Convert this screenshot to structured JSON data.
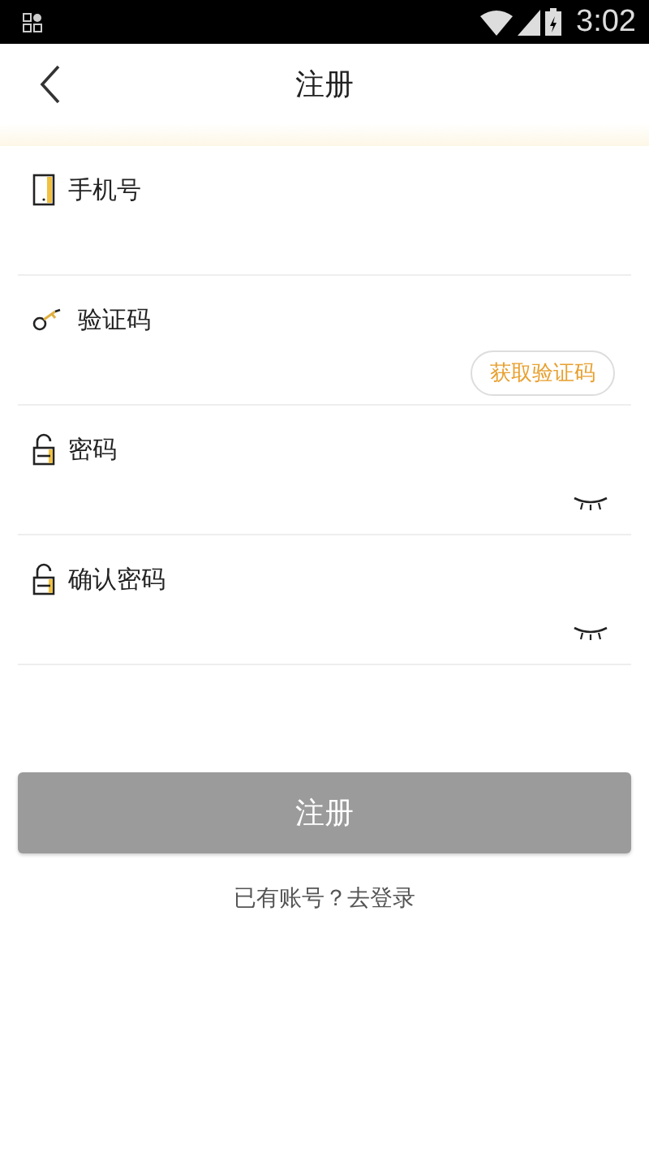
{
  "status_bar": {
    "time": "3:02"
  },
  "header": {
    "title": "注册"
  },
  "fields": [
    {
      "kind": "phone",
      "label": "手机号"
    },
    {
      "kind": "code",
      "label": "验证码",
      "action": "获取验证码"
    },
    {
      "kind": "password",
      "label": "密码"
    },
    {
      "kind": "password",
      "label": "确认密码"
    }
  ],
  "submit": {
    "label": "注册",
    "disabled": true
  },
  "login_link": "已有账号？去登录"
}
